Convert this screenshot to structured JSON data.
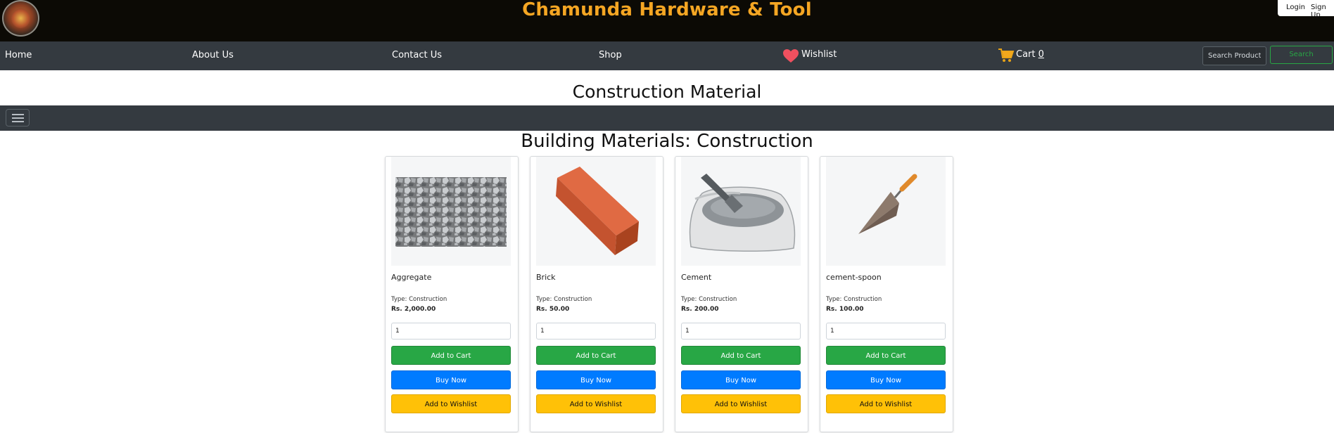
{
  "header": {
    "brand_title": "Chamunda Hardware & Tool",
    "login_label": "Login",
    "signup_label": "Sign Up",
    "brand_color": "#f5a623"
  },
  "nav": {
    "items": [
      {
        "label": "Home"
      },
      {
        "label": "About Us"
      },
      {
        "label": "Contact Us"
      },
      {
        "label": "Shop"
      },
      {
        "label": "Wishlist",
        "icon": "heart-icon"
      },
      {
        "label": "Cart",
        "icon": "cart-icon",
        "count": "0"
      }
    ],
    "search_placeholder": "Search Products",
    "search_button": "Search"
  },
  "page": {
    "title": "Construction Material",
    "section_title": "Building Materials: Construction"
  },
  "products": [
    {
      "name": "Aggregate",
      "type": "Type: Construction",
      "price": "Rs. 2,000.00",
      "quantity": "1",
      "image": "gravel-image"
    },
    {
      "name": "Brick",
      "type": "Type: Construction",
      "price": "Rs. 50.00",
      "quantity": "1",
      "image": "brick-image"
    },
    {
      "name": "Cement",
      "type": "Type: Construction",
      "price": "Rs. 200.00",
      "quantity": "1",
      "image": "cement-bag-image"
    },
    {
      "name": "cement-spoon",
      "type": "Type: Construction",
      "price": "Rs. 100.00",
      "quantity": "1",
      "image": "trowel-image"
    }
  ],
  "buttons": {
    "add_to_cart": "Add to Cart",
    "buy_now": "Buy Now",
    "add_to_wishlist": "Add to Wishlist"
  },
  "colors": {
    "navbar": "#343a40",
    "add_to_cart": "#28a745",
    "buy_now": "#007bff",
    "add_to_wishlist": "#ffc107"
  }
}
